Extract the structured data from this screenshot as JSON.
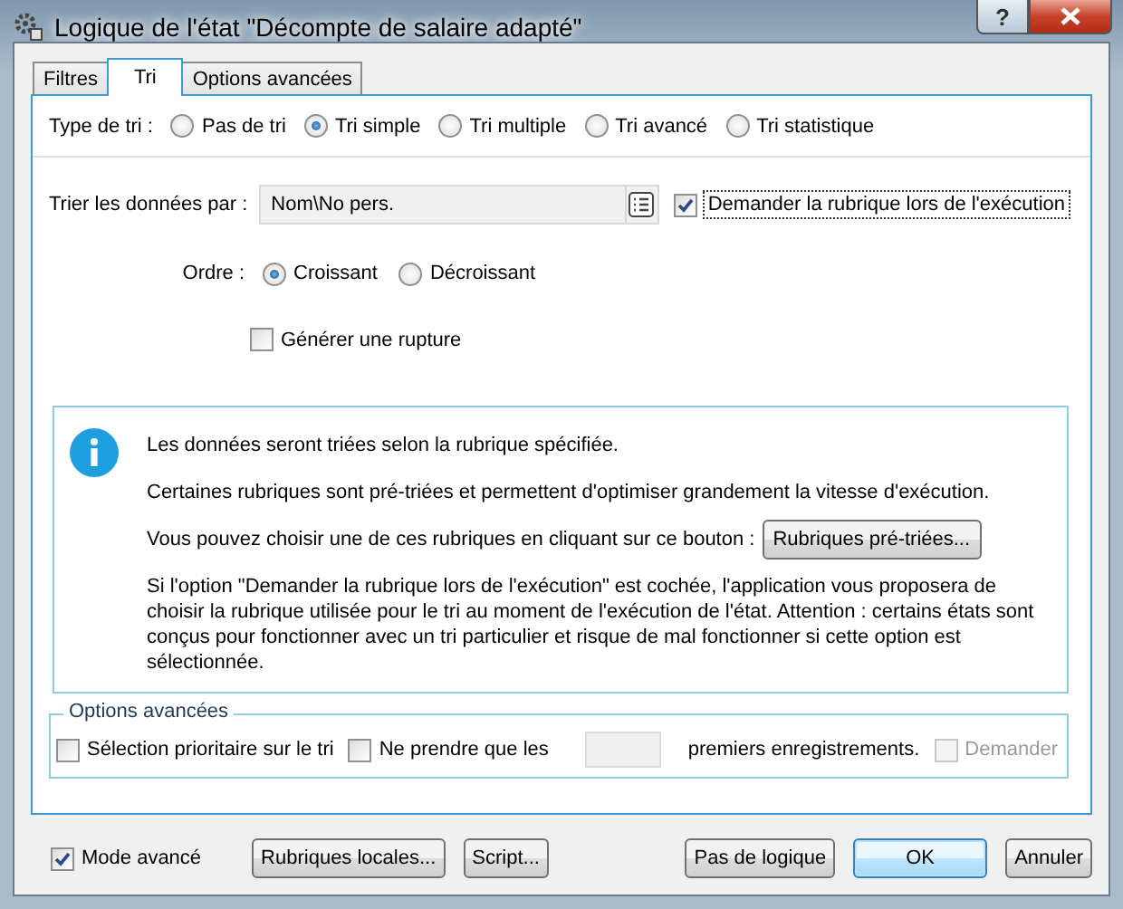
{
  "window": {
    "title": "Logique de l'état \"Décompte de salaire adapté\"",
    "help_button": "?"
  },
  "tabs": [
    {
      "label": "Filtres",
      "selected": false
    },
    {
      "label": "Tri",
      "selected": true
    },
    {
      "label": "Options avancées",
      "selected": false
    }
  ],
  "sort_type": {
    "label": "Type de tri :",
    "options": [
      {
        "label": "Pas de tri",
        "selected": false
      },
      {
        "label": "Tri simple",
        "selected": true
      },
      {
        "label": "Tri multiple",
        "selected": false
      },
      {
        "label": "Tri avancé",
        "selected": false
      },
      {
        "label": "Tri statistique",
        "selected": false
      }
    ]
  },
  "sort_by": {
    "label": "Trier les données par :",
    "value": "Nom\\No pers.",
    "ask_checkbox": {
      "label": "Demander la rubrique lors de l'exécution",
      "checked": true
    }
  },
  "order": {
    "label": "Ordre :",
    "options": [
      {
        "label": "Croissant",
        "selected": true
      },
      {
        "label": "Décroissant",
        "selected": false
      }
    ]
  },
  "break_checkbox": {
    "label": "Générer une rupture",
    "checked": false
  },
  "info": {
    "paragraphs": [
      {
        "text": "Les données seront triées selon la rubrique spécifiée."
      },
      {
        "text": "Certaines rubriques sont pré-triées et permettent d'optimiser grandement la vitesse d'exécution."
      },
      {
        "text": "Vous pouvez choisir une de ces rubriques en cliquant sur ce bouton :",
        "button": "Rubriques pré-triées..."
      },
      {
        "text": "Si l'option \"Demander la rubrique lors de l'exécution\" est cochée, l'application vous proposera de choisir la rubrique utilisée pour le tri au moment de l'exécution de l'état. Attention : certains états sont conçus pour fonctionner avec un tri particulier et risque de mal fonctionner si cette option est sélectionnée."
      }
    ]
  },
  "advanced_options": {
    "title": "Options avancées",
    "priority_checkbox": {
      "label": "Sélection prioritaire sur le tri",
      "checked": false,
      "disabled": false
    },
    "limit_checkbox": {
      "label": "Ne prendre que les",
      "checked": false,
      "disabled": false
    },
    "limit_suffix": "premiers enregistrements.",
    "ask_checkbox": {
      "label": "Demander",
      "checked": false,
      "disabled": true
    }
  },
  "footer": {
    "mode_checkbox": {
      "label": "Mode avancé",
      "checked": true
    },
    "left_buttons": [
      {
        "label": "Rubriques locales...",
        "default": false
      },
      {
        "label": "Script...",
        "default": false
      }
    ],
    "right_buttons": [
      {
        "label": "Pas de logique",
        "default": false
      },
      {
        "label": "OK",
        "default": true
      },
      {
        "label": "Annuler",
        "default": false
      }
    ]
  }
}
